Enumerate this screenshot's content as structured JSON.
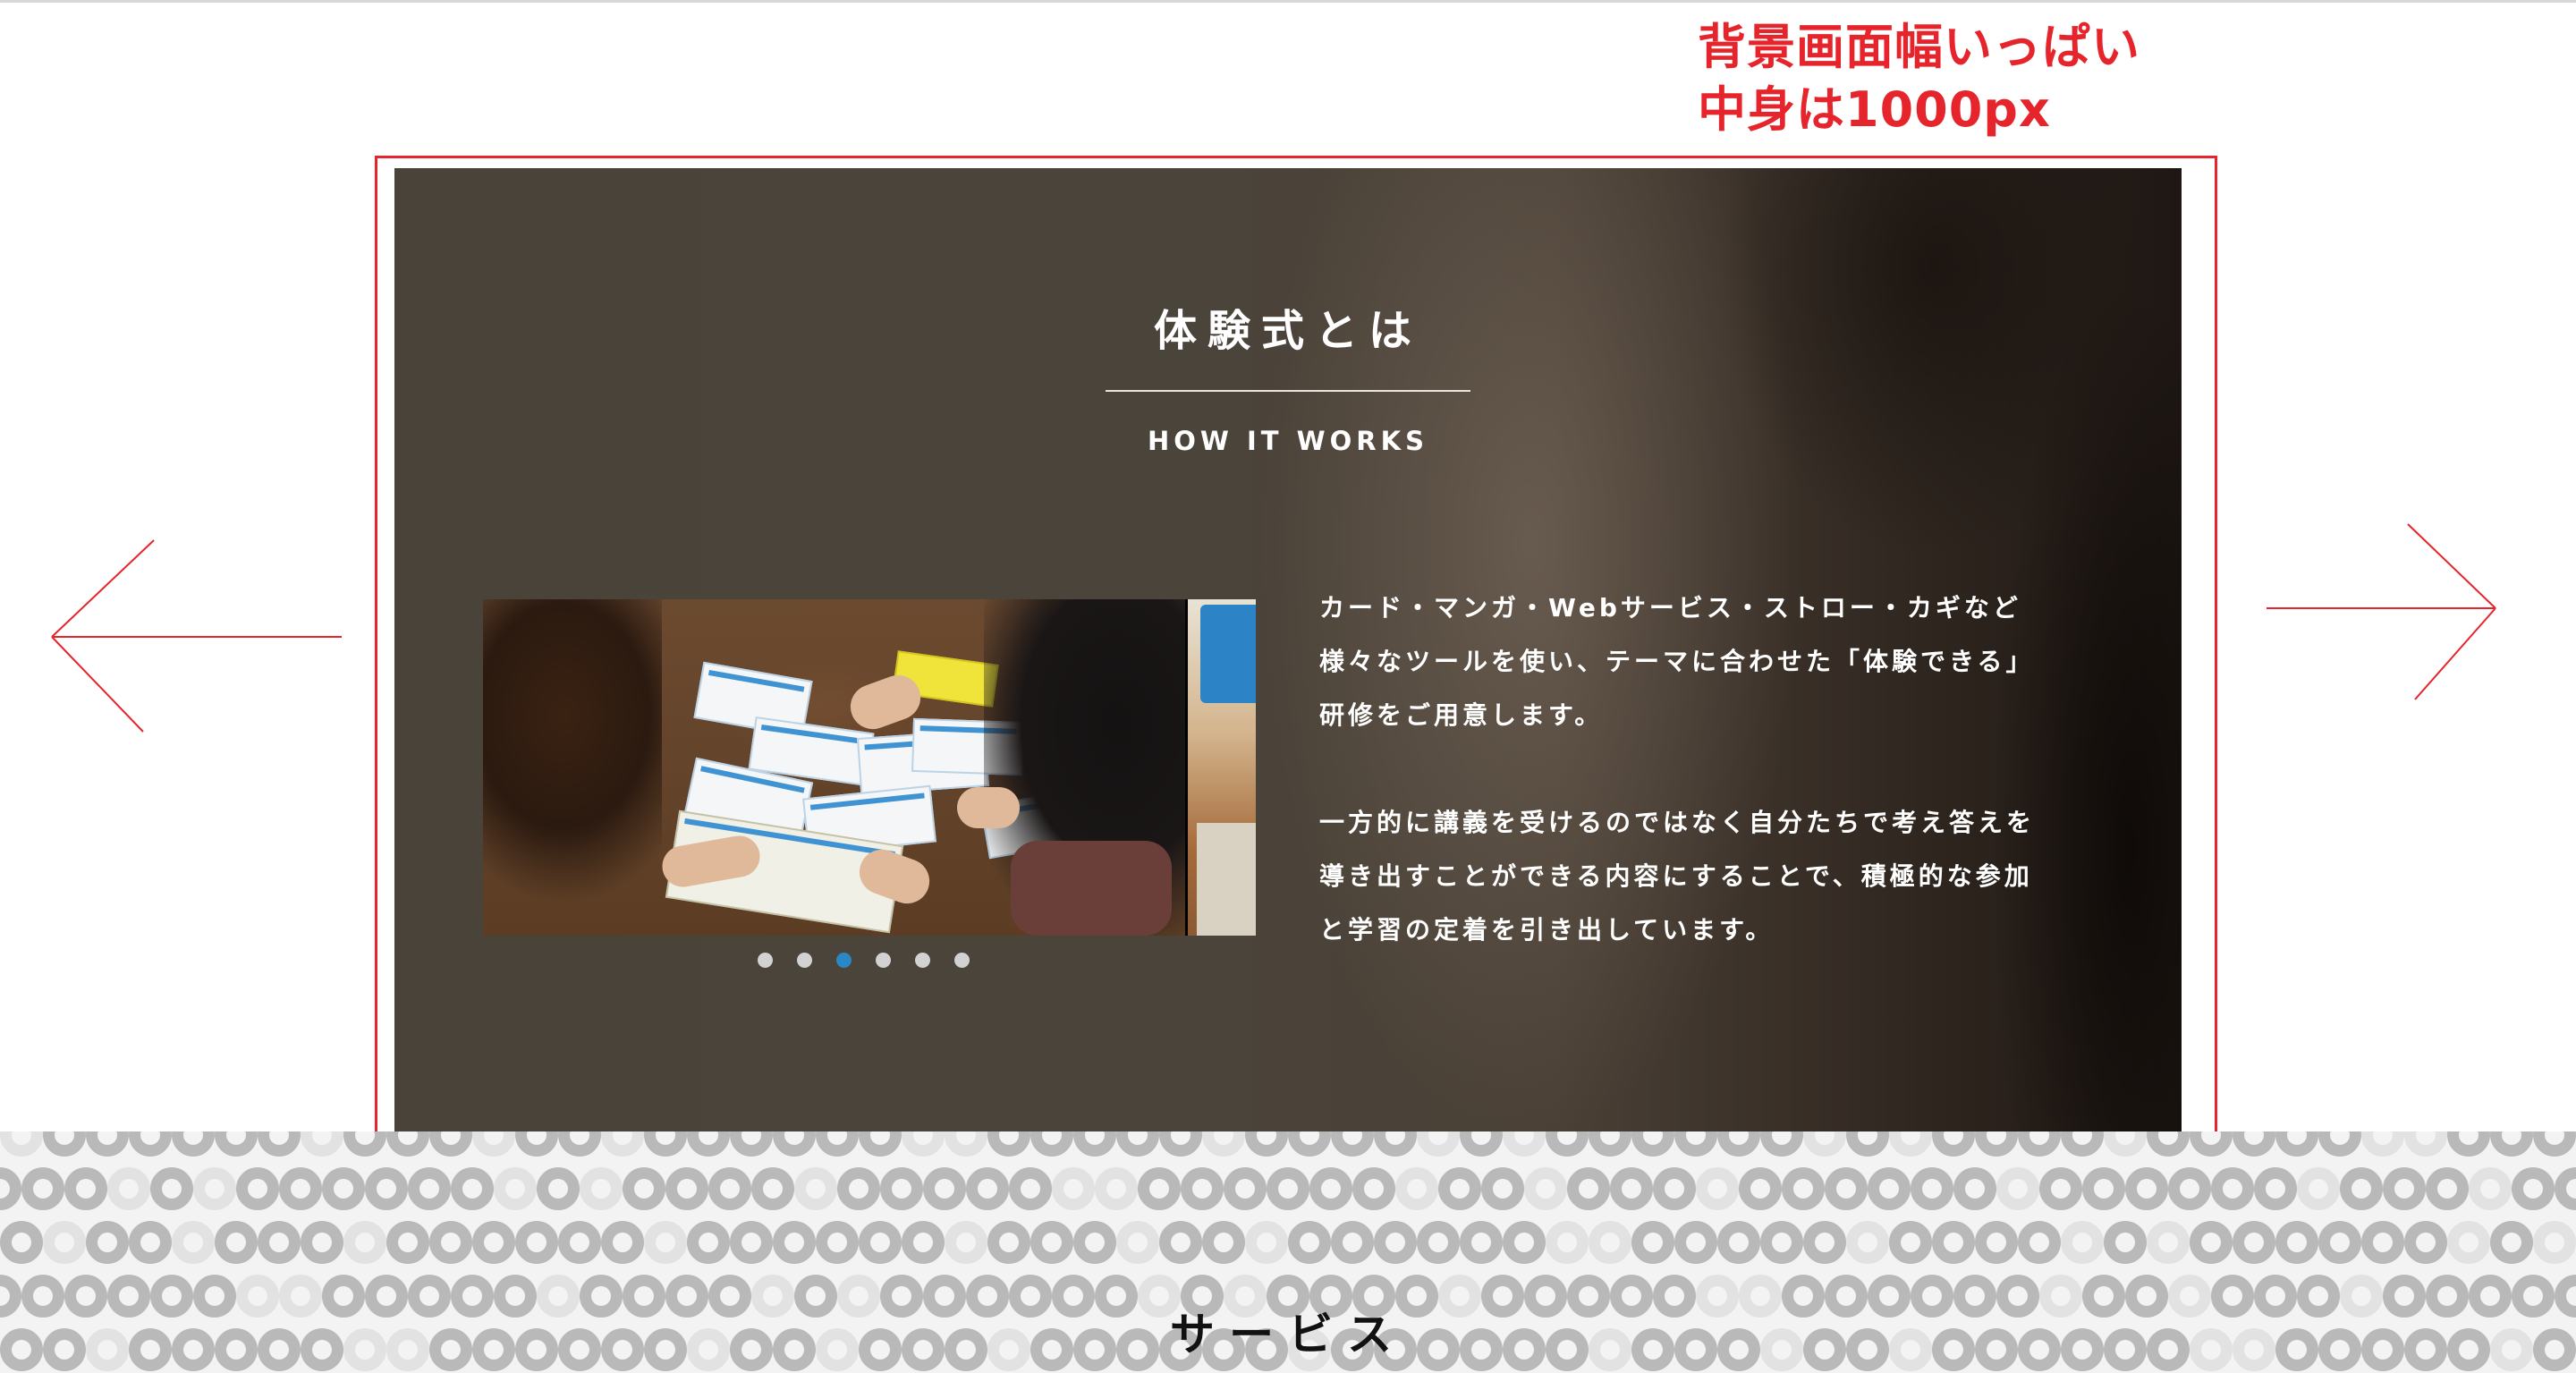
{
  "annotation": {
    "line1": "背景画面幅いっぱい",
    "line2": "中身は1000px",
    "color": "#e6242b"
  },
  "hero": {
    "title": "体験式とは",
    "subtitle": "HOW IT WORKS",
    "paragraph1": [
      "カード・マンガ・Webサービス・ストロー・カギなど",
      "様々なツールを使い、テーマに合わせた「体験できる」",
      "研修をご用意します。"
    ],
    "paragraph2": [
      "一方的に講義を受けるのではなく自分たちで考え答えを",
      "導き出すことができる内容にすることで、積極的な参加",
      "と学習の定着を引き出しています。"
    ]
  },
  "slider": {
    "dot_count": 6,
    "active_index": 2,
    "active_color": "#2a88c4"
  },
  "arrows": {
    "prev_icon": "arrow-left-icon",
    "next_icon": "arrow-right-icon"
  },
  "section": {
    "title": "サービス"
  }
}
